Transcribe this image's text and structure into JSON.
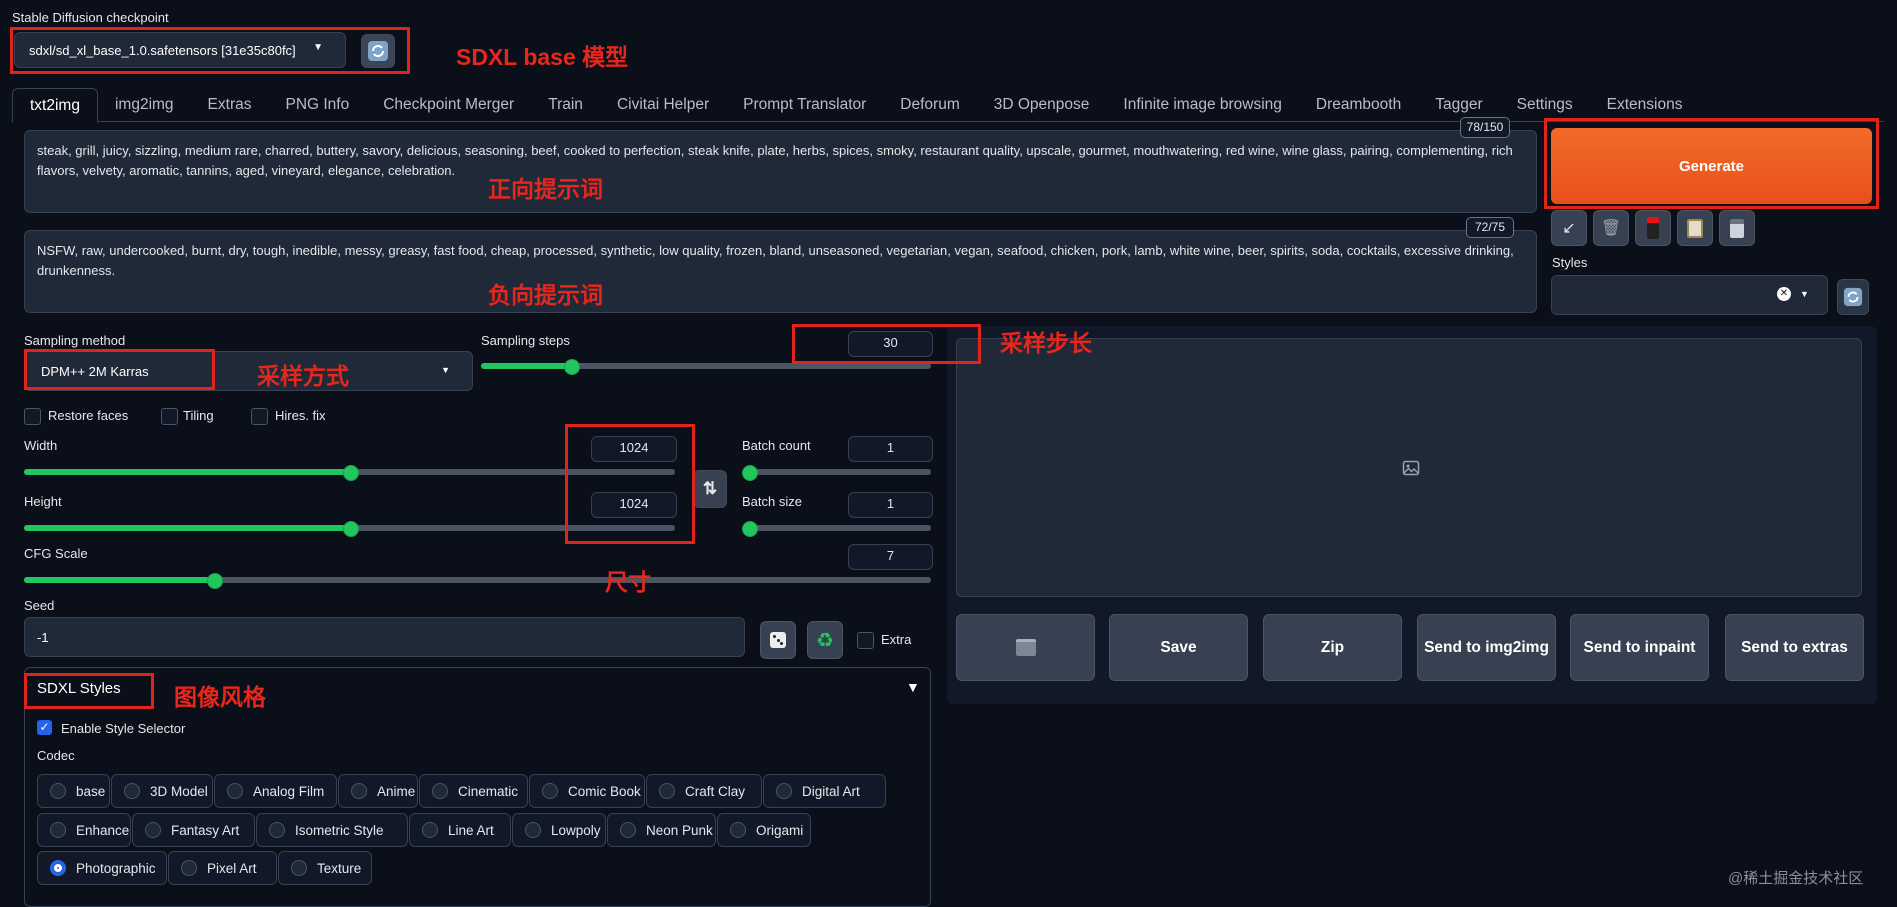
{
  "checkpoint": {
    "label": "Stable Diffusion checkpoint",
    "value": "sdxl/sd_xl_base_1.0.safetensors [31e35c80fc]",
    "refresh_icon": "refresh-icon"
  },
  "tabs": [
    "txt2img",
    "img2img",
    "Extras",
    "PNG Info",
    "Checkpoint Merger",
    "Train",
    "Civitai Helper",
    "Prompt Translator",
    "Deforum",
    "3D Openpose",
    "Infinite image browsing",
    "Dreambooth",
    "Tagger",
    "Settings",
    "Extensions"
  ],
  "active_tab": "txt2img",
  "prompt": {
    "text": "steak, grill, juicy, sizzling, medium rare, charred, buttery, savory, delicious, seasoning, beef, cooked to perfection, steak knife, plate, herbs, spices, smoky, restaurant quality, upscale, gourmet, mouthwatering, red wine, wine glass, pairing, complementing, rich flavors, velvety, aromatic, tannins, aged, vineyard, elegance, celebration.",
    "counter": "78/150"
  },
  "negative_prompt": {
    "text": "NSFW, raw, undercooked, burnt, dry, tough, inedible, messy, greasy, fast food, cheap, processed, synthetic, low quality, frozen, bland, unseasoned, vegetarian, vegan, seafood, chicken, pork, lamb, white wine, beer, spirits, soda, cocktails, excessive drinking, drunkenness.",
    "counter": "72/75"
  },
  "generate": {
    "label": "Generate",
    "color": "#f05a1e"
  },
  "tool_icons": [
    "arrow-down-left-icon",
    "trash-icon",
    "red-card-icon",
    "clipboard-icon",
    "save-disk-icon"
  ],
  "styles": {
    "label": "Styles",
    "value": "",
    "clear": "✕"
  },
  "sampling": {
    "method_label": "Sampling method",
    "method_value": "DPM++ 2M Karras",
    "steps_label": "Sampling steps",
    "steps_value": "30",
    "steps_fraction": 0.2
  },
  "checkboxes": {
    "restore_faces": "Restore faces",
    "tiling": "Tiling",
    "hires_fix": "Hires. fix"
  },
  "width": {
    "label": "Width",
    "value": "1024",
    "fraction": 0.5
  },
  "height": {
    "label": "Height",
    "value": "1024",
    "fraction": 0.5
  },
  "swap_icon": "swap-arrows-icon",
  "batch_count": {
    "label": "Batch count",
    "value": "1",
    "fraction": 0
  },
  "batch_size": {
    "label": "Batch size",
    "value": "1",
    "fraction": 0
  },
  "cfg": {
    "label": "CFG Scale",
    "value": "7",
    "fraction": 0.21
  },
  "seed": {
    "label": "Seed",
    "value": "-1",
    "dice_icon": "dice-icon",
    "recycle_icon": "recycle-icon",
    "extra_label": "Extra"
  },
  "sdxl_styles": {
    "title": "SDXL Styles",
    "collapse_icon": "▼",
    "enable_label": "Enable Style Selector",
    "codec_label": "Codec",
    "options": [
      "base",
      "3D Model",
      "Analog Film",
      "Anime",
      "Cinematic",
      "Comic Book",
      "Craft Clay",
      "Digital Art",
      "Enhance",
      "Fantasy Art",
      "Isometric Style",
      "Line Art",
      "Lowpoly",
      "Neon Punk",
      "Origami",
      "Photographic",
      "Pixel Art",
      "Texture"
    ],
    "selected": "Photographic"
  },
  "output_buttons": {
    "folder_icon": "folder-icon",
    "save": "Save",
    "zip": "Zip",
    "send_img2img": "Send to img2img",
    "send_inpaint": "Send to inpaint",
    "send_extras": "Send to extras"
  },
  "image_placeholder_icon": "image-icon",
  "annotations": {
    "model": "SDXL base 模型",
    "positive": "正向提示词",
    "negative": "负向提示词",
    "sampling_method": "采样方式",
    "sampling_steps": "采样步长",
    "size": "尺寸",
    "style": "图像风格"
  },
  "watermark": "@稀土掘金技术社区"
}
